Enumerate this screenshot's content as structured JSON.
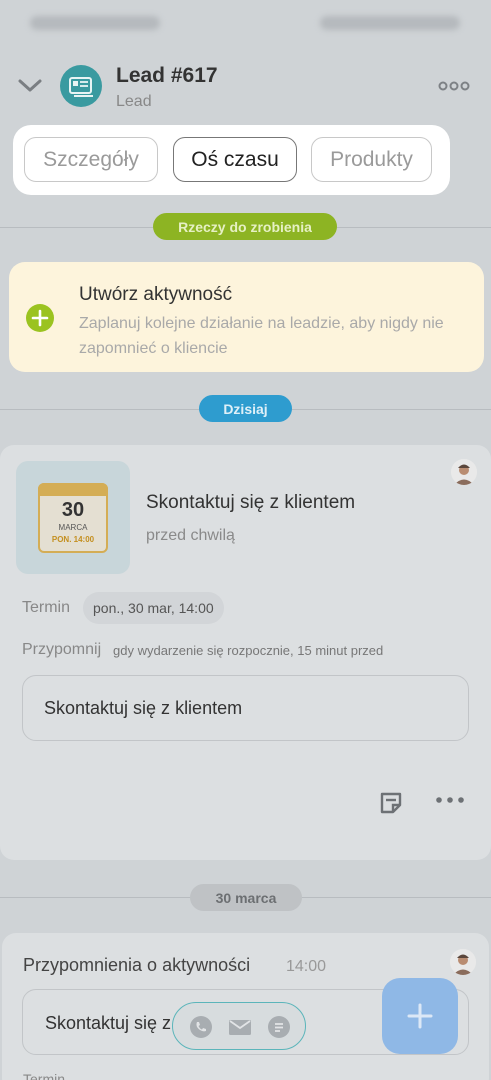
{
  "header": {
    "title": "Lead #617",
    "subtitle": "Lead"
  },
  "tabs": [
    {
      "label": "Szczegóły",
      "active": false
    },
    {
      "label": "Oś czasu",
      "active": true
    },
    {
      "label": "Produkty",
      "active": false
    }
  ],
  "sections": {
    "todo_label": "Rzeczy do zrobienia",
    "today_label": "Dzisiaj",
    "date_label": "30 marca"
  },
  "create_activity": {
    "title": "Utwórz aktywność",
    "description": "Zaplanuj kolejne działanie na leadzie, aby nigdy nie zapomnieć o kliencie"
  },
  "activity": {
    "calendar_day": "30",
    "calendar_month": "MARCA",
    "calendar_dow": "PON. 14:00",
    "title": "Skontaktuj się z klientem",
    "time": "przed chwilą",
    "termin_label": "Termin",
    "termin_value": "pon., 30 mar, 14:00",
    "remind_label": "Przypomnij",
    "remind_value": "gdy wydarzenie się rozpocznie, 15 minut przed",
    "note": "Skontaktuj się z klientem"
  },
  "activity2": {
    "title": "Przypomnienia o aktywności",
    "time": "14:00",
    "note": "Skontaktuj się z",
    "label": "Termin"
  },
  "colors": {
    "accent_green": "#9bc320",
    "accent_blue": "#2e9ccf",
    "create_bg": "#fdf4dc",
    "fab": "#8fb8e6"
  },
  "icons": [
    "chevron-down-icon",
    "lead-card-icon",
    "more-horizontal-icon",
    "plus-icon",
    "calendar-icon",
    "note-icon",
    "phone-icon",
    "mail-icon",
    "chat-icon",
    "add-icon"
  ]
}
